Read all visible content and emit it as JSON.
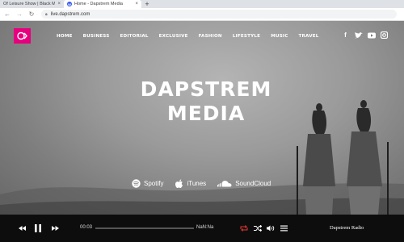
{
  "browser": {
    "tabs": [
      {
        "title": "Of Leisure Show | Black Ma",
        "active": false
      },
      {
        "title": "Home - Dapstrem Media",
        "active": true
      }
    ],
    "url": "live.dapstrem.com"
  },
  "site": {
    "nav": [
      "HOME",
      "BUSINESS",
      "EDITORIAL",
      "EXCLUSIVE",
      "FASHION",
      "LIFESTYLE",
      "MUSIC",
      "TRAVEL"
    ],
    "social": [
      "facebook-icon",
      "twitter-icon",
      "youtube-icon",
      "instagram-icon"
    ],
    "hero": {
      "line1": "DAPSTREM",
      "line2": "MEDIA"
    },
    "platforms": [
      {
        "label": "Spotify",
        "icon": "spotify-icon"
      },
      {
        "label": "iTunes",
        "icon": "apple-icon"
      },
      {
        "label": "SoundCloud",
        "icon": "soundcloud-icon"
      }
    ],
    "accent": "#e6007e"
  },
  "player": {
    "current_time": "00:03",
    "total_time": "NaN:Na",
    "progress": 0.0,
    "station": "Dapstrem Radio",
    "loop_color": "#e53935"
  }
}
